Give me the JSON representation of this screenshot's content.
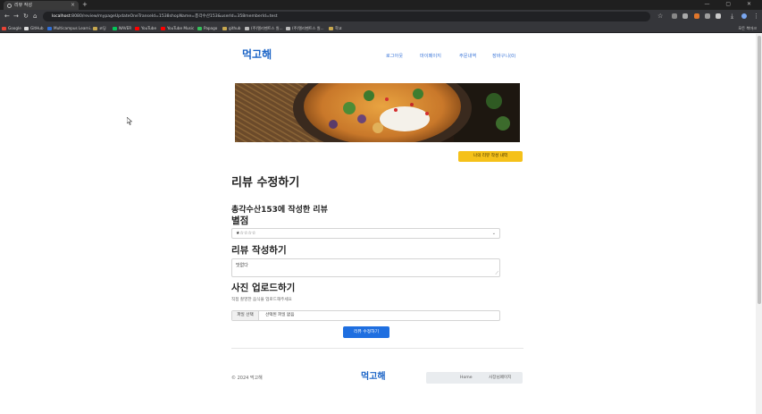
{
  "browser": {
    "tab_title": "리뷰 작성",
    "new_tab_symbol": "+",
    "tab_close_symbol": "×",
    "window_controls": "— ▢ ✕",
    "url_host": "localhost",
    "url_rest": ":8080/review/mypageUpdateOneTranseId=1538shopName=총각수산153&userId=358memberId=test",
    "bookmarks": [
      {
        "label": "Google",
        "color": "#ea4335"
      },
      {
        "label": "GitHub",
        "color": "#dddddd"
      },
      {
        "label": "Multicampus Learni...",
        "color": "#2f6fd8"
      },
      {
        "label": "코딩",
        "color": "#c8a84f"
      },
      {
        "label": "NAVER",
        "color": "#03c75a"
      },
      {
        "label": "YouTube",
        "color": "#ff0000"
      },
      {
        "label": "YouTube Music",
        "color": "#ff0000"
      },
      {
        "label": "Papago",
        "color": "#35c05a"
      },
      {
        "label": "github",
        "color": "#c8a84f"
      },
      {
        "label": "(주)엘리멘트스 원...",
        "color": "#bbbbbb"
      },
      {
        "label": "(주)엘리멘트스 원...",
        "color": "#bbbbbb"
      },
      {
        "label": "학교",
        "color": "#c8a84f"
      }
    ],
    "all_bookmarks": "모든 북마크"
  },
  "header": {
    "logo": "먹고해",
    "nav": [
      "로그아웃",
      "마이페이지",
      "주문내역",
      "장바구니(0)"
    ]
  },
  "main": {
    "my_reviews_button": "나의 리뷰 작성 내역",
    "page_title": "리뷰 수정하기",
    "store_line": "총각수산153에 작성한 리뷰",
    "rating_heading": "별점",
    "rating_value": "★☆☆☆☆",
    "review_heading": "리뷰 작성하기",
    "review_text": "맛없다",
    "photo_heading": "사진 업로드하기",
    "photo_hint": "직접 촬영한 음식을 업로드해주세요",
    "file_button": "파일 선택",
    "file_status": "선택된 파일 없음",
    "submit_button": "리뷰 수정하기"
  },
  "footer": {
    "copyright": "© 2024 먹고해",
    "logo": "먹고해",
    "nav": [
      "Home",
      "사장님페이지"
    ]
  },
  "colors": {
    "brand_blue": "#1a63c6",
    "accent_yellow": "#f5c11a",
    "submit_blue": "#1f6fe0"
  }
}
